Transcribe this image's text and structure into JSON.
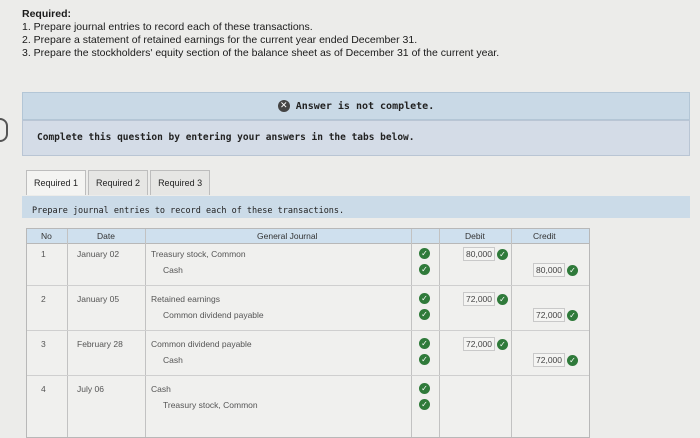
{
  "required": {
    "heading": "Required:",
    "items": [
      "1. Prepare journal entries to record each of these transactions.",
      "2. Prepare a statement of retained earnings for the current year ended December 31.",
      "3. Prepare the stockholders' equity section of the balance sheet as of December 31 of the current year."
    ]
  },
  "banner": {
    "text": "Answer is not complete."
  },
  "instruction": "Complete this question by entering your answers in the tabs below.",
  "tabs": [
    "Required 1",
    "Required 2",
    "Required 3"
  ],
  "subheading": "Prepare journal entries to record each of these transactions.",
  "table": {
    "headers": {
      "no": "No",
      "date": "Date",
      "journal": "General Journal",
      "debit": "Debit",
      "credit": "Credit"
    },
    "entries": [
      {
        "no": "1",
        "date": "January 02",
        "lines": [
          {
            "account": "Treasury stock, Common",
            "debit": "80,000",
            "credit": ""
          },
          {
            "account": "Cash",
            "debit": "",
            "credit": "80,000"
          }
        ]
      },
      {
        "no": "2",
        "date": "January 05",
        "lines": [
          {
            "account": "Retained earnings",
            "debit": "72,000",
            "credit": ""
          },
          {
            "account": "Common dividend payable",
            "debit": "",
            "credit": "72,000"
          }
        ]
      },
      {
        "no": "3",
        "date": "February 28",
        "lines": [
          {
            "account": "Common dividend payable",
            "debit": "72,000",
            "credit": ""
          },
          {
            "account": "Cash",
            "debit": "",
            "credit": "72,000"
          }
        ]
      },
      {
        "no": "4",
        "date": "July 06",
        "lines": [
          {
            "account": "Cash",
            "debit": "",
            "credit": ""
          },
          {
            "account": "Treasury stock, Common",
            "debit": "",
            "credit": ""
          }
        ]
      }
    ]
  },
  "colors": {
    "correct": "#2f7a3a",
    "banner_bg": "#c9d9e6",
    "header_bg": "#cfe0ee"
  }
}
